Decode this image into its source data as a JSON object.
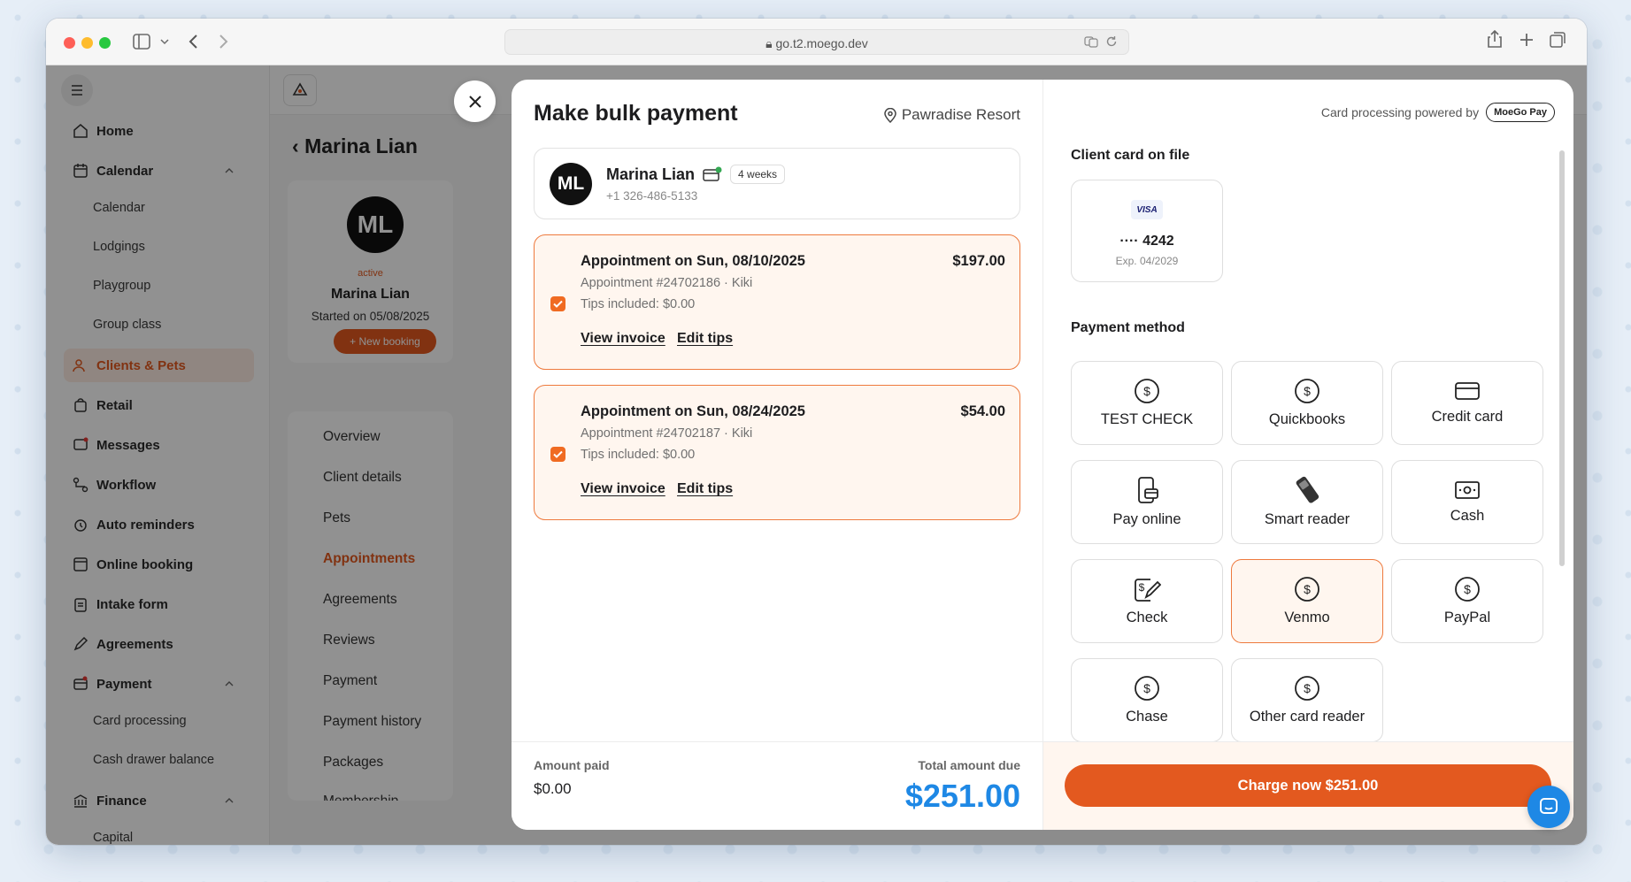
{
  "browser": {
    "url": "go.t2.moego.dev"
  },
  "sidebar": {
    "items": [
      {
        "label": "Home"
      },
      {
        "label": "Calendar"
      },
      {
        "label": "Calendar"
      },
      {
        "label": "Lodgings"
      },
      {
        "label": "Playgroup"
      },
      {
        "label": "Group class"
      },
      {
        "label": "Clients & Pets"
      },
      {
        "label": "Retail"
      },
      {
        "label": "Messages"
      },
      {
        "label": "Workflow"
      },
      {
        "label": "Auto reminders"
      },
      {
        "label": "Online booking"
      },
      {
        "label": "Intake form"
      },
      {
        "label": "Agreements"
      },
      {
        "label": "Payment"
      },
      {
        "label": "Card processing"
      },
      {
        "label": "Cash drawer balance"
      },
      {
        "label": "Finance"
      },
      {
        "label": "Capital"
      }
    ]
  },
  "client_page": {
    "back_title": "Marina Lian",
    "initials": "ML",
    "status": "active",
    "name": "Marina Lian",
    "started": "Started on 05/08/2025",
    "new_booking": "+ New booking",
    "nav": [
      "Overview",
      "Client details",
      "Pets",
      "Appointments",
      "Agreements",
      "Reviews",
      "Payment",
      "Payment history",
      "Packages",
      "Membership"
    ]
  },
  "modal": {
    "title": "Make bulk payment",
    "location": "Pawradise Resort",
    "client": {
      "initials": "ML",
      "name": "Marina Lian",
      "badge": "4 weeks",
      "phone": "+1 326-486-5133"
    },
    "appointments": [
      {
        "title": "Appointment on Sun, 08/10/2025",
        "amount": "$197.00",
        "sub": "Appointment #24702186 · Kiki",
        "tips": "Tips included: $0.00",
        "view": "View invoice",
        "edit": "Edit tips"
      },
      {
        "title": "Appointment on Sun, 08/24/2025",
        "amount": "$54.00",
        "sub": "Appointment #24702187 · Kiki",
        "tips": "Tips included: $0.00",
        "view": "View invoice",
        "edit": "Edit tips"
      }
    ],
    "amount_paid_label": "Amount paid",
    "amount_paid": "$0.00",
    "total_due_label": "Total amount due",
    "total_due": "$251.00",
    "powered_by": "Card processing powered by",
    "moego_pay": "MoeGo Pay",
    "card_on_file_title": "Client card on file",
    "card": {
      "brand": "VISA",
      "last4": "···· 4242",
      "exp": "Exp. 04/2029"
    },
    "payment_method_title": "Payment method",
    "methods": [
      {
        "label": "TEST CHECK",
        "icon": "dollar-circle-icon"
      },
      {
        "label": "Quickbooks",
        "icon": "dollar-circle-icon"
      },
      {
        "label": "Credit card",
        "icon": "credit-card-icon"
      },
      {
        "label": "Pay online",
        "icon": "phone-card-icon"
      },
      {
        "label": "Smart reader",
        "icon": "card-reader-icon"
      },
      {
        "label": "Cash",
        "icon": "cash-icon"
      },
      {
        "label": "Check",
        "icon": "check-pen-icon"
      },
      {
        "label": "Venmo",
        "icon": "dollar-circle-icon",
        "selected": true
      },
      {
        "label": "PayPal",
        "icon": "dollar-circle-icon"
      },
      {
        "label": "Chase",
        "icon": "dollar-circle-icon"
      },
      {
        "label": "Other card reader",
        "icon": "dollar-circle-icon"
      }
    ],
    "charge_button": "Charge now $251.00"
  },
  "colors": {
    "accent": "#e3591f",
    "total_blue": "#1e88e5",
    "selected_bg": "#fff6ef"
  }
}
